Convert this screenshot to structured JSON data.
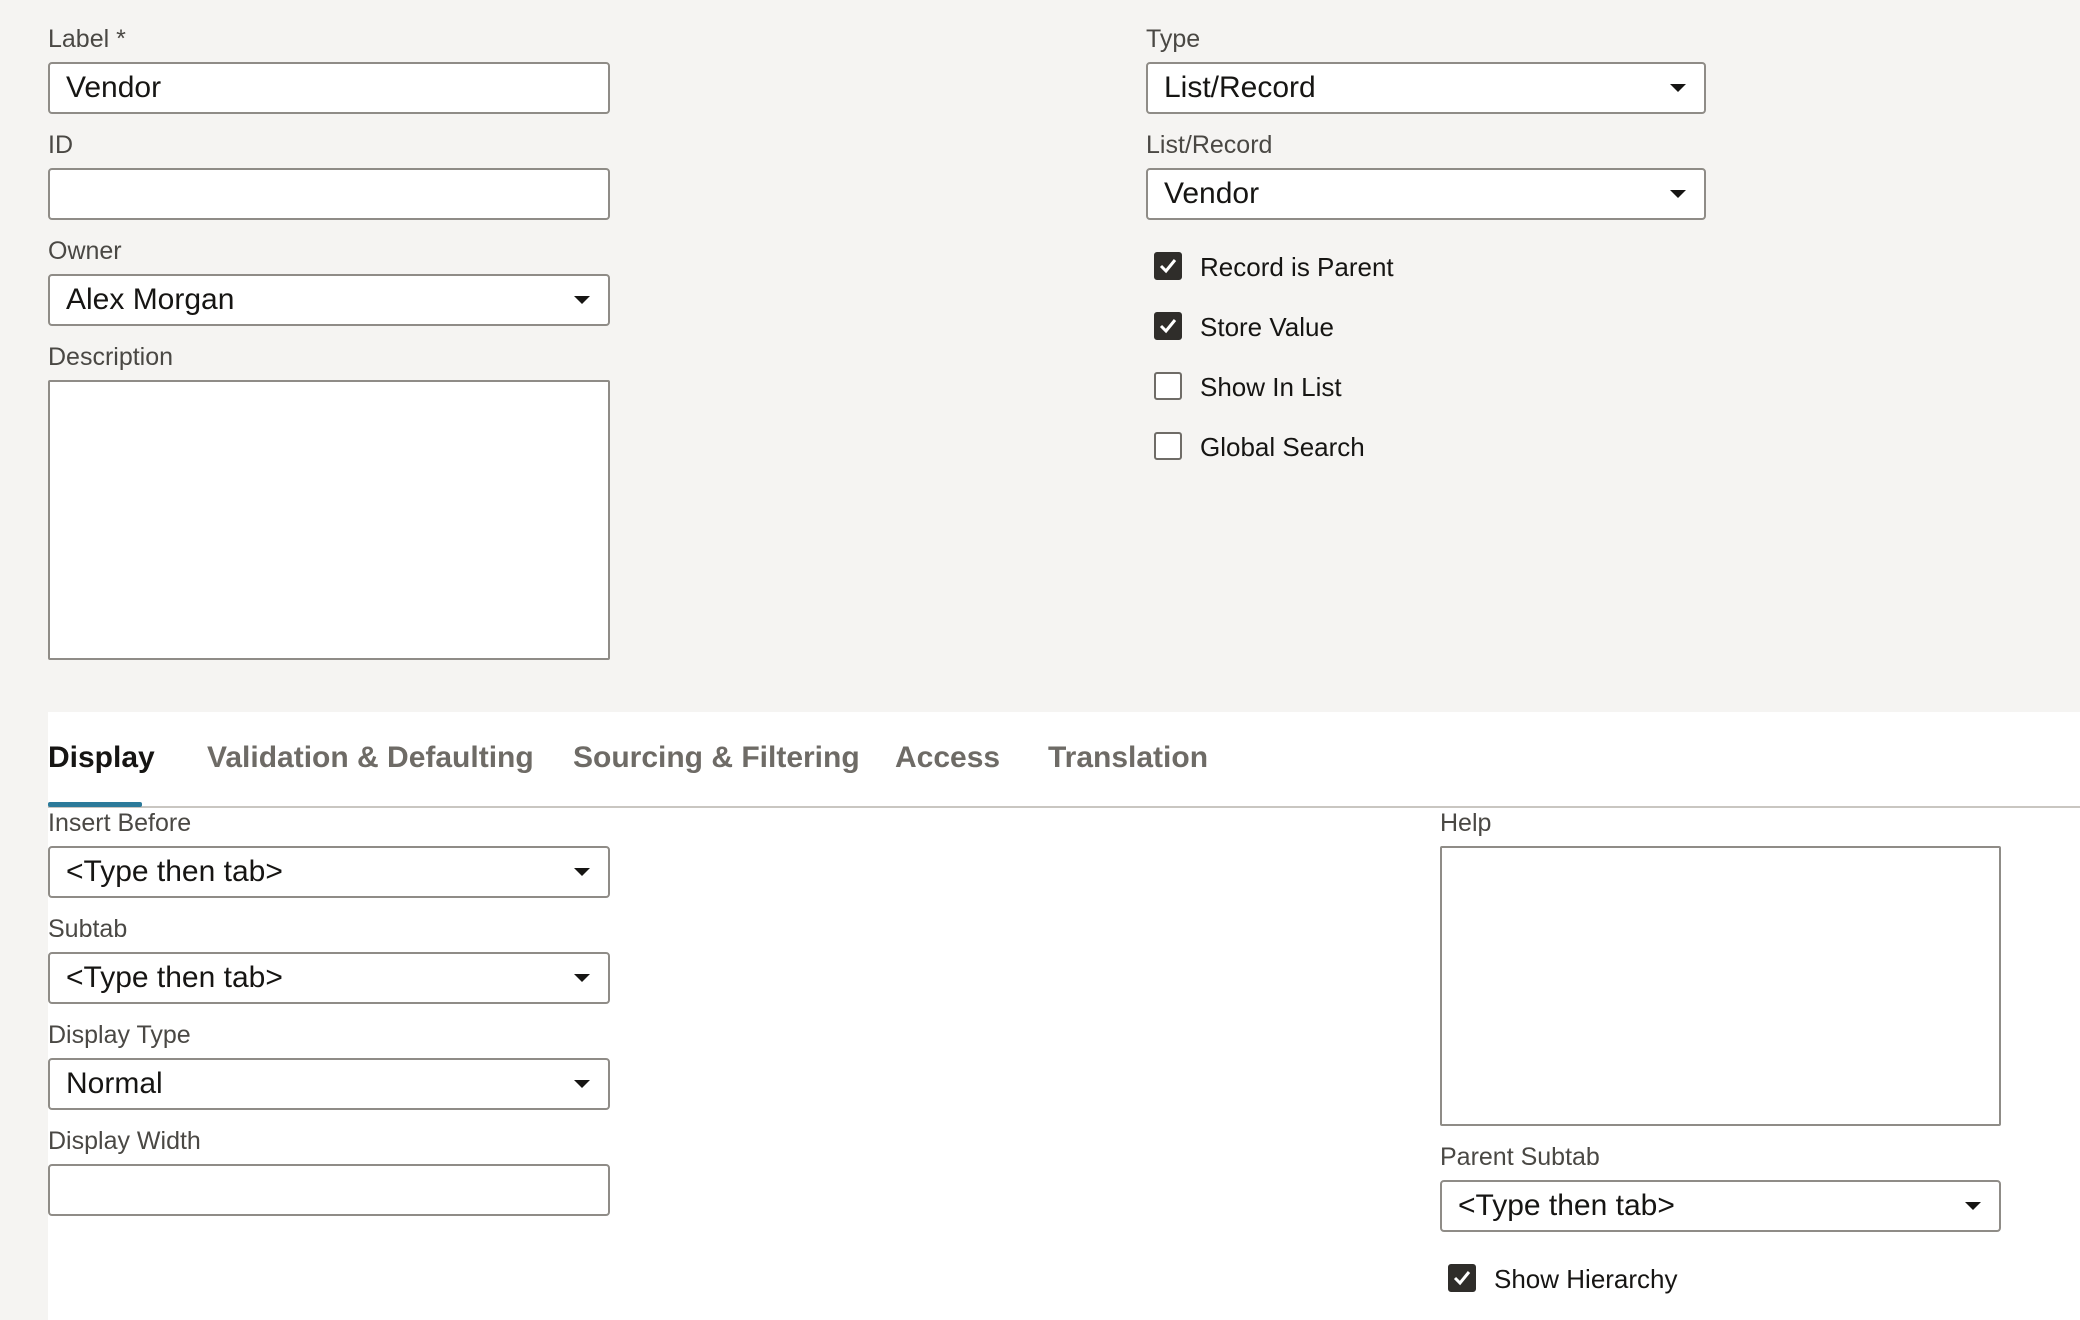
{
  "top": {
    "label_field": {
      "label": "Label *",
      "value": "Vendor"
    },
    "id_field": {
      "label": "ID",
      "value": ""
    },
    "owner_field": {
      "label": "Owner",
      "value": "Alex Morgan"
    },
    "description_field": {
      "label": "Description",
      "value": ""
    },
    "type_field": {
      "label": "Type",
      "value": "List/Record"
    },
    "list_record_field": {
      "label": "List/Record",
      "value": "Vendor"
    },
    "checkboxes": [
      {
        "label": "Record is Parent",
        "checked": true
      },
      {
        "label": "Store Value",
        "checked": true
      },
      {
        "label": "Show In List",
        "checked": false
      },
      {
        "label": "Global Search",
        "checked": false
      }
    ]
  },
  "tabs": [
    {
      "label": "Display",
      "active": true
    },
    {
      "label": "Validation & Defaulting",
      "active": false
    },
    {
      "label": "Sourcing & Filtering",
      "active": false
    },
    {
      "label": "Access",
      "active": false
    },
    {
      "label": "Translation",
      "active": false
    }
  ],
  "display": {
    "insert_before": {
      "label": "Insert Before",
      "value": "<Type then tab>"
    },
    "subtab": {
      "label": "Subtab",
      "value": "<Type then tab>"
    },
    "display_type": {
      "label": "Display Type",
      "value": "Normal"
    },
    "display_width": {
      "label": "Display Width",
      "value": ""
    },
    "help": {
      "label": "Help",
      "value": ""
    },
    "parent_subtab": {
      "label": "Parent Subtab",
      "value": "<Type then tab>"
    },
    "show_hierarchy": {
      "label": "Show Hierarchy",
      "checked": true
    }
  },
  "colors": {
    "background": "#f5f4f2",
    "panel": "#ffffff",
    "tab_indicator": "#2c7a9a",
    "checkbox_on": "#2f2d2a"
  }
}
